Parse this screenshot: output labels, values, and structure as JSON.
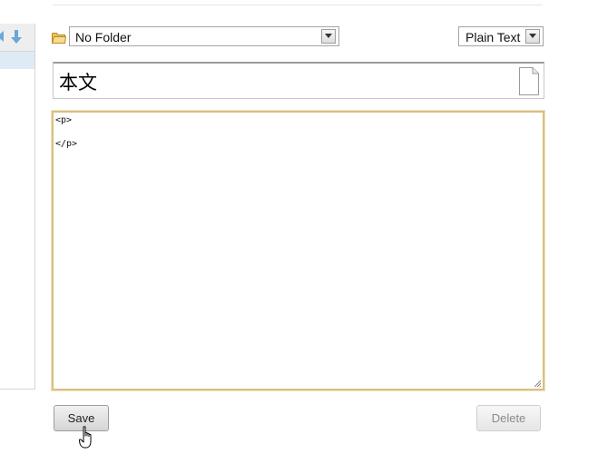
{
  "toolbar": {
    "folder_select": {
      "selected": "No Folder",
      "icon": "folder-icon"
    },
    "format_select": {
      "selected": "Plain Text"
    }
  },
  "note": {
    "title": "本文",
    "title_icon": "document-icon",
    "body_lines": [
      "<p>",
      "</p>"
    ]
  },
  "actions": {
    "save_label": "Save",
    "delete_label": "Delete"
  },
  "sidebar": {
    "icons": [
      "arrow-left-icon",
      "arrow-down-icon"
    ]
  },
  "colors": {
    "editor_focus_border": "#d9bf80",
    "sidebar_selected": "#deebf7",
    "arrow_blue": "#6aa8d8"
  }
}
